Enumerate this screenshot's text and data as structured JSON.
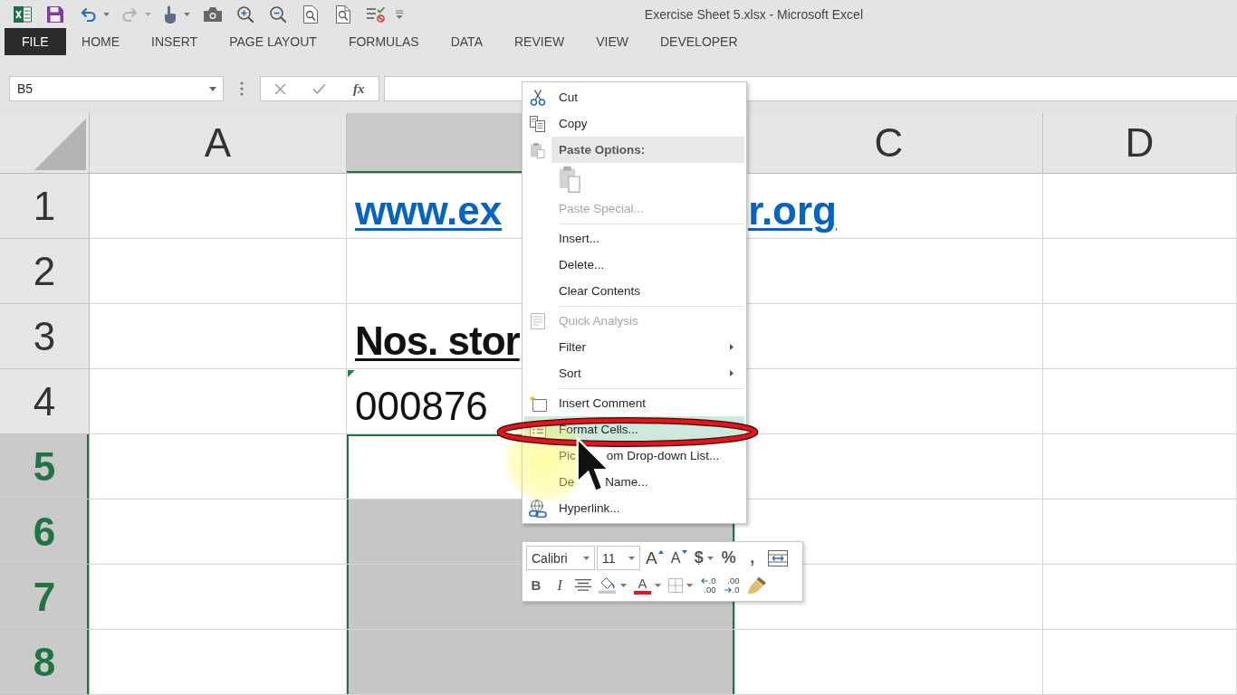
{
  "window": {
    "title": "Exercise Sheet 5.xlsx - Microsoft Excel"
  },
  "quick_access_toolbar": {
    "undo": {
      "disabled": false
    },
    "redo": {
      "disabled": true
    }
  },
  "ribbon_tabs": [
    {
      "kind": "file",
      "label": "FILE",
      "selected": false
    },
    {
      "kind": "tab",
      "label": "HOME",
      "selected": false
    },
    {
      "kind": "tab",
      "label": "INSERT",
      "selected": false
    },
    {
      "kind": "tab",
      "label": "PAGE LAYOUT",
      "selected": false
    },
    {
      "kind": "tab",
      "label": "FORMULAS",
      "selected": false
    },
    {
      "kind": "tab",
      "label": "DATA",
      "selected": false
    },
    {
      "kind": "tab",
      "label": "REVIEW",
      "selected": false
    },
    {
      "kind": "tab",
      "label": "VIEW",
      "selected": false
    },
    {
      "kind": "tab",
      "label": "DEVELOPER",
      "selected": false
    }
  ],
  "formula_bar": {
    "name_box": "B5",
    "function_button": "fx"
  },
  "sheet": {
    "columns": [
      {
        "label": "A",
        "selected": false
      },
      {
        "selected": true
      },
      {
        "label": "C",
        "selected": false
      },
      {
        "label": "D",
        "selected": false
      }
    ],
    "rows": [
      {
        "label": "1",
        "selected": false,
        "cells": [
          {
            "selected": false,
            "active": false
          },
          {
            "selected": false,
            "active": false,
            "kind": "link",
            "parts": [
              "www.ex",
              "r.org"
            ]
          },
          {
            "selected": false,
            "active": false
          },
          {
            "selected": false,
            "active": false
          }
        ]
      },
      {
        "label": "2",
        "selected": false,
        "cells": [
          {
            "selected": false,
            "active": false
          },
          {
            "selected": false,
            "active": false
          },
          {
            "selected": false,
            "active": false
          },
          {
            "selected": false,
            "active": false
          }
        ]
      },
      {
        "label": "3",
        "selected": false,
        "cells": [
          {
            "selected": false,
            "active": false
          },
          {
            "selected": false,
            "active": false,
            "kind": "heading",
            "text": "Nos. stor"
          },
          {
            "selected": false,
            "active": false
          },
          {
            "selected": false,
            "active": false
          }
        ]
      },
      {
        "label": "4",
        "selected": false,
        "cells": [
          {
            "selected": false,
            "active": false
          },
          {
            "selected": false,
            "active": false,
            "kind": "plain",
            "text": "000876",
            "error_flag": true
          },
          {
            "selected": false,
            "active": false
          },
          {
            "selected": false,
            "active": false
          }
        ]
      },
      {
        "label": "5",
        "selected": true,
        "cells": [
          {
            "selected": false,
            "active": false
          },
          {
            "selected": true,
            "active": true
          },
          {
            "selected": false,
            "active": false
          },
          {
            "selected": false,
            "active": false
          }
        ]
      },
      {
        "label": "6",
        "selected": true,
        "cells": [
          {
            "selected": false,
            "active": false
          },
          {
            "selected": true,
            "active": false
          },
          {
            "selected": false,
            "active": false
          },
          {
            "selected": false,
            "active": false
          }
        ]
      },
      {
        "label": "7",
        "selected": true,
        "cells": [
          {
            "selected": false,
            "active": false
          },
          {
            "selected": true,
            "active": false
          },
          {
            "selected": false,
            "active": false
          },
          {
            "selected": false,
            "active": false
          }
        ]
      },
      {
        "label": "8",
        "selected": true,
        "cells": [
          {
            "selected": false,
            "active": false
          },
          {
            "selected": true,
            "active": false
          },
          {
            "selected": false,
            "active": false
          },
          {
            "selected": false,
            "active": false
          }
        ]
      }
    ]
  },
  "context_menu": {
    "items": [
      {
        "kind": "command",
        "label": "Cut",
        "disabled": false,
        "selected": false,
        "submenu": false
      },
      {
        "kind": "command",
        "label": "Copy",
        "disabled": false,
        "selected": false,
        "submenu": false
      },
      {
        "kind": "header",
        "label": "Paste Options:"
      },
      {
        "kind": "paste-icons",
        "disabled": true
      },
      {
        "kind": "command",
        "label": "Paste Special...",
        "disabled": true,
        "selected": false,
        "submenu": false
      },
      {
        "kind": "separator"
      },
      {
        "kind": "command",
        "label": "Insert...",
        "disabled": false,
        "selected": false,
        "submenu": false
      },
      {
        "kind": "command",
        "label": "Delete...",
        "disabled": false,
        "selected": false,
        "submenu": false
      },
      {
        "kind": "command",
        "label": "Clear Contents",
        "disabled": false,
        "selected": false,
        "submenu": false
      },
      {
        "kind": "separator"
      },
      {
        "kind": "command",
        "label": "Quick Analysis",
        "disabled": true,
        "selected": false,
        "submenu": false
      },
      {
        "kind": "command",
        "label": "Filter",
        "disabled": false,
        "selected": false,
        "submenu": true
      },
      {
        "kind": "command",
        "label": "Sort",
        "disabled": false,
        "selected": false,
        "submenu": true
      },
      {
        "kind": "separator"
      },
      {
        "kind": "command",
        "label": "Insert Comment",
        "disabled": false,
        "selected": false,
        "submenu": false
      },
      {
        "kind": "command",
        "label": "Format Cells...",
        "disabled": false,
        "selected": true,
        "submenu": false
      },
      {
        "kind": "command",
        "parts": [
          "Pic",
          "om Drop-down List..."
        ],
        "disabled": false,
        "selected": false,
        "submenu": false
      },
      {
        "kind": "command",
        "parts": [
          "De",
          "Name..."
        ],
        "disabled": false,
        "selected": false,
        "submenu": false
      },
      {
        "kind": "command",
        "label": "Hyperlink...",
        "disabled": false,
        "selected": false,
        "submenu": false
      }
    ]
  },
  "mini_toolbar": {
    "rows": [
      {
        "buttons": [
          {
            "kind": "font-combo",
            "value": "Calibri"
          },
          {
            "kind": "size-combo",
            "value": "11"
          },
          {
            "kind": "grow-font",
            "label": "A"
          },
          {
            "kind": "shrink-font",
            "label": "A"
          },
          {
            "kind": "currency",
            "label": "$",
            "dropdown": true
          },
          {
            "kind": "percent",
            "label": "%"
          },
          {
            "kind": "comma",
            "label": ","
          },
          {
            "kind": "merge-center"
          }
        ]
      },
      {
        "buttons": [
          {
            "kind": "bold",
            "label": "B"
          },
          {
            "kind": "italic",
            "label": "I"
          },
          {
            "kind": "center"
          },
          {
            "kind": "fill-color",
            "dropdown": true
          },
          {
            "kind": "font-color",
            "label": "A",
            "dropdown": true
          },
          {
            "kind": "borders",
            "dropdown": true
          },
          {
            "kind": "increase-decimal",
            "labels": [
              ".0",
              ".00"
            ]
          },
          {
            "kind": "decrease-decimal",
            "labels": [
              ".00",
              ".0"
            ]
          },
          {
            "kind": "format-painter"
          }
        ]
      }
    ]
  }
}
